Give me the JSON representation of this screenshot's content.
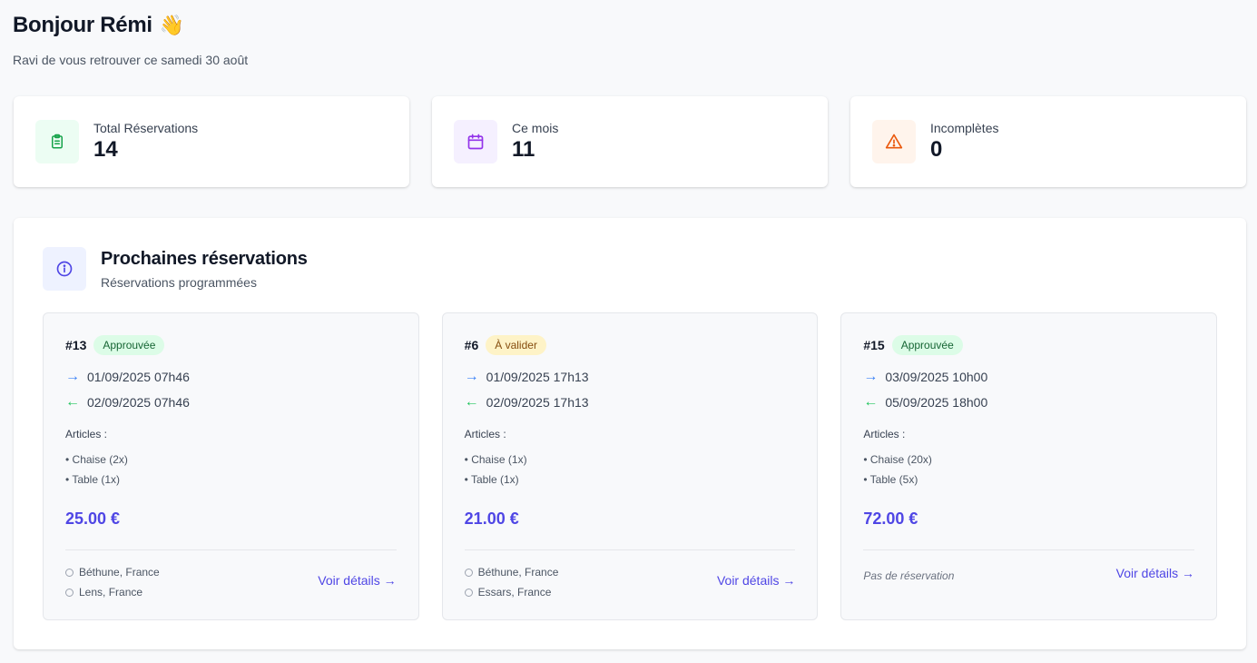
{
  "header": {
    "greeting": "Bonjour Rémi",
    "wave_emoji": "👋",
    "subtitle": "Ravi de vous retrouver ce samedi 30 août"
  },
  "stats": [
    {
      "label": "Total Réservations",
      "value": "14",
      "icon": "clipboard-icon",
      "color": "#16a34a",
      "bg": "#ecfdf3"
    },
    {
      "label": "Ce mois",
      "value": "11",
      "icon": "calendar-icon",
      "color": "#9333ea",
      "bg": "#f5f0ff"
    },
    {
      "label": "Incomplètes",
      "value": "0",
      "icon": "warning-icon",
      "color": "#ea580c",
      "bg": "#fff4ec"
    }
  ],
  "upcoming": {
    "title": "Prochaines réservations",
    "subtitle": "Réservations programmées",
    "articles_label": "Articles :",
    "details_label": "Voir détails →",
    "cards": [
      {
        "id": "#13",
        "status": "Approuvée",
        "start": "01/09/2025 07h46",
        "end": "02/09/2025 07h46",
        "article_1": "• Chaise (2x)",
        "article_2": "• Table (1x)",
        "price": "25.00 €",
        "location_1": "Béthune, France",
        "location_2": "Lens, France"
      },
      {
        "id": "#6",
        "status": "À valider",
        "start": "01/09/2025 17h13",
        "end": "02/09/2025 17h13",
        "article_1": "• Chaise (1x)",
        "article_2": "• Table (1x)",
        "price": "21.00 €",
        "location_1": "Béthune, France",
        "location_2": "Essars, France"
      },
      {
        "id": "#15",
        "status": "Approuvée",
        "start": "03/09/2025 10h00",
        "end": "05/09/2025 18h00",
        "article_1": "• Chaise (20x)",
        "article_2": "• Table (5x)",
        "price": "72.00 €",
        "no_location": "Pas de réservation"
      }
    ]
  },
  "colors": {
    "accent": "#4f46e5",
    "approved_bg": "#dcfce7",
    "pending_bg": "#fef3c7",
    "arrow_out": "#3b82f6",
    "arrow_in": "#22c55e"
  }
}
